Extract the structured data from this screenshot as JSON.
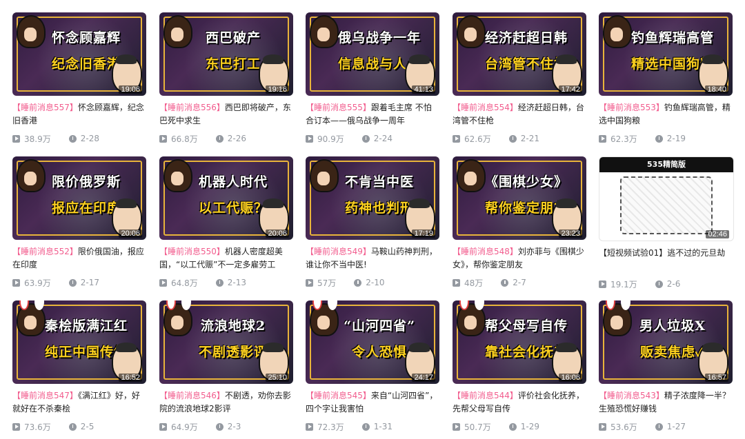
{
  "videos": [
    {
      "line1": "怀念顾嘉辉",
      "line2": "纪念旧香港",
      "duration": "19:06",
      "tag": "【睡前消息557】",
      "title": "怀念顾嘉辉，纪念旧香港",
      "views": "38.9万",
      "date": "2-28",
      "style": "normal"
    },
    {
      "line1": "西巴破产",
      "line2": "东巴打工",
      "duration": "19:16",
      "tag": "【睡前消息556】",
      "title": "西巴即将破产，东巴死中求生",
      "views": "66.8万",
      "date": "2-26",
      "style": "normal"
    },
    {
      "line1": "俄乌战争一年",
      "line2": "信息战与人心",
      "duration": "41:13",
      "tag": "【睡前消息555】",
      "title": "跟着毛主席 不怕合订本——俄乌战争一周年",
      "views": "90.9万",
      "date": "2-24",
      "style": "normal"
    },
    {
      "line1": "经济赶超日韩",
      "line2": "台湾管不住枪",
      "duration": "17:42",
      "tag": "【睡前消息554】",
      "title": "经济赶超日韩，台湾管不住枪",
      "views": "62.6万",
      "date": "2-21",
      "style": "normal"
    },
    {
      "line1": "钓鱼辉瑞高管",
      "line2": "精选中国狗粮",
      "duration": "18:40",
      "tag": "【睡前消息553】",
      "title": "钓鱼辉瑞高管，精选中国狗粮",
      "views": "62.3万",
      "date": "2-19",
      "style": "normal"
    },
    {
      "line1": "限价俄罗斯",
      "line2": "报应在印度",
      "duration": "20:06",
      "tag": "【睡前消息552】",
      "title": "限价俄国油，报应在印度",
      "views": "63.9万",
      "date": "2-17",
      "style": "normal"
    },
    {
      "line1": "机器人时代",
      "line2": "以工代赈？",
      "duration": "20:06",
      "tag": "【睡前消息550】",
      "title": "机器人密度超美国，“以工代赈”不一定多雇劳工",
      "views": "64.8万",
      "date": "2-13",
      "style": "normal"
    },
    {
      "line1": "不肯当中医",
      "line2": "药神也判刑",
      "duration": "17:19",
      "tag": "【睡前消息549】",
      "title": "马鞍山药神判刑，谁让你不当中医!",
      "views": "57万",
      "date": "2-10",
      "style": "normal"
    },
    {
      "line1": "《围棋少女》",
      "line2": "帮你鉴定朋友",
      "duration": "23:23",
      "tag": "【睡前消息548】",
      "title": "刘亦菲与《围棋少女》，帮你鉴定朋友",
      "views": "48万",
      "date": "2-7",
      "style": "normal"
    },
    {
      "line1": "535精简版",
      "line2": "",
      "duration": "02:46",
      "tag": "",
      "title": "【短视频试验01】逃不过的元旦劫",
      "views": "19.1万",
      "date": "2-6",
      "style": "white"
    },
    {
      "line1": "秦桧版满江红",
      "line2": "纯正中国传统",
      "duration": "16:52",
      "tag": "【睡前消息547】",
      "title": "《满江红》好，好就好在不杀秦桧",
      "views": "73.6万",
      "date": "2-5",
      "style": "bunny"
    },
    {
      "line1": "流浪地球2",
      "line2": "不剧透影评",
      "duration": "25:10",
      "tag": "【睡前消息546】",
      "title": "不剧透，劝你去影院的流浪地球2影评",
      "views": "64.9万",
      "date": "2-3",
      "style": "bunny"
    },
    {
      "line1": "“山河四省”",
      "line2": "令人恐惧",
      "duration": "24:17",
      "tag": "【睡前消息545】",
      "title": "来自“山河四省”，四个字让我害怕",
      "views": "72.3万",
      "date": "1-31",
      "style": "bunny"
    },
    {
      "line1": "帮父母写自传",
      "line2": "靠社会化抚养",
      "duration": "16:06",
      "tag": "【睡前消息544】",
      "title": "评价社会化抚养，先帮父母写自传",
      "views": "50.7万",
      "date": "1-29",
      "style": "bunny"
    },
    {
      "line1": "男人垃圾X",
      "line2": "贩卖焦虑✓",
      "duration": "16:57",
      "tag": "【睡前消息543】",
      "title": "精子浓度降一半？生殖恐慌好赚钱",
      "views": "53.6万",
      "date": "1-27",
      "style": "bunny"
    }
  ]
}
